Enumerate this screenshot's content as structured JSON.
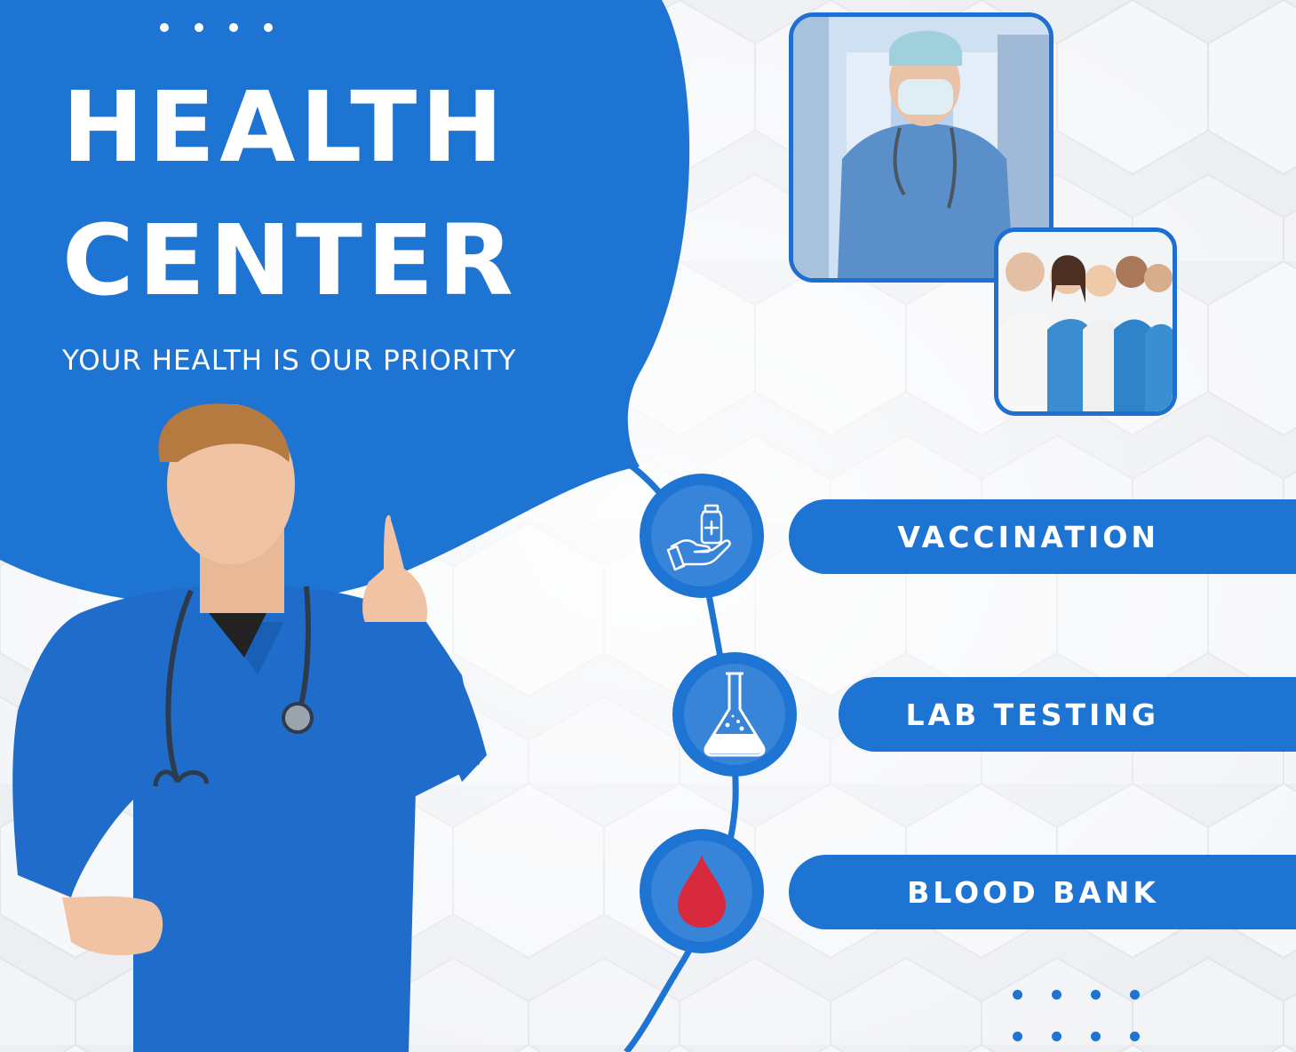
{
  "header": {
    "title_line1": "HEALTH",
    "title_line2": "CENTER",
    "tagline": "YOUR HEALTH IS OUR PRIORITY"
  },
  "services": [
    {
      "label": "VACCINATION",
      "icon": "vaccine-hand-icon"
    },
    {
      "label": "LAB TESTING",
      "icon": "flask-icon"
    },
    {
      "label": "BLOOD BANK",
      "icon": "blood-drop-icon"
    }
  ],
  "colors": {
    "brand_blue": "#1e74d2",
    "icon_blue": "#3884d8",
    "blood_red": "#d9293e",
    "background": "#eef0f3"
  }
}
